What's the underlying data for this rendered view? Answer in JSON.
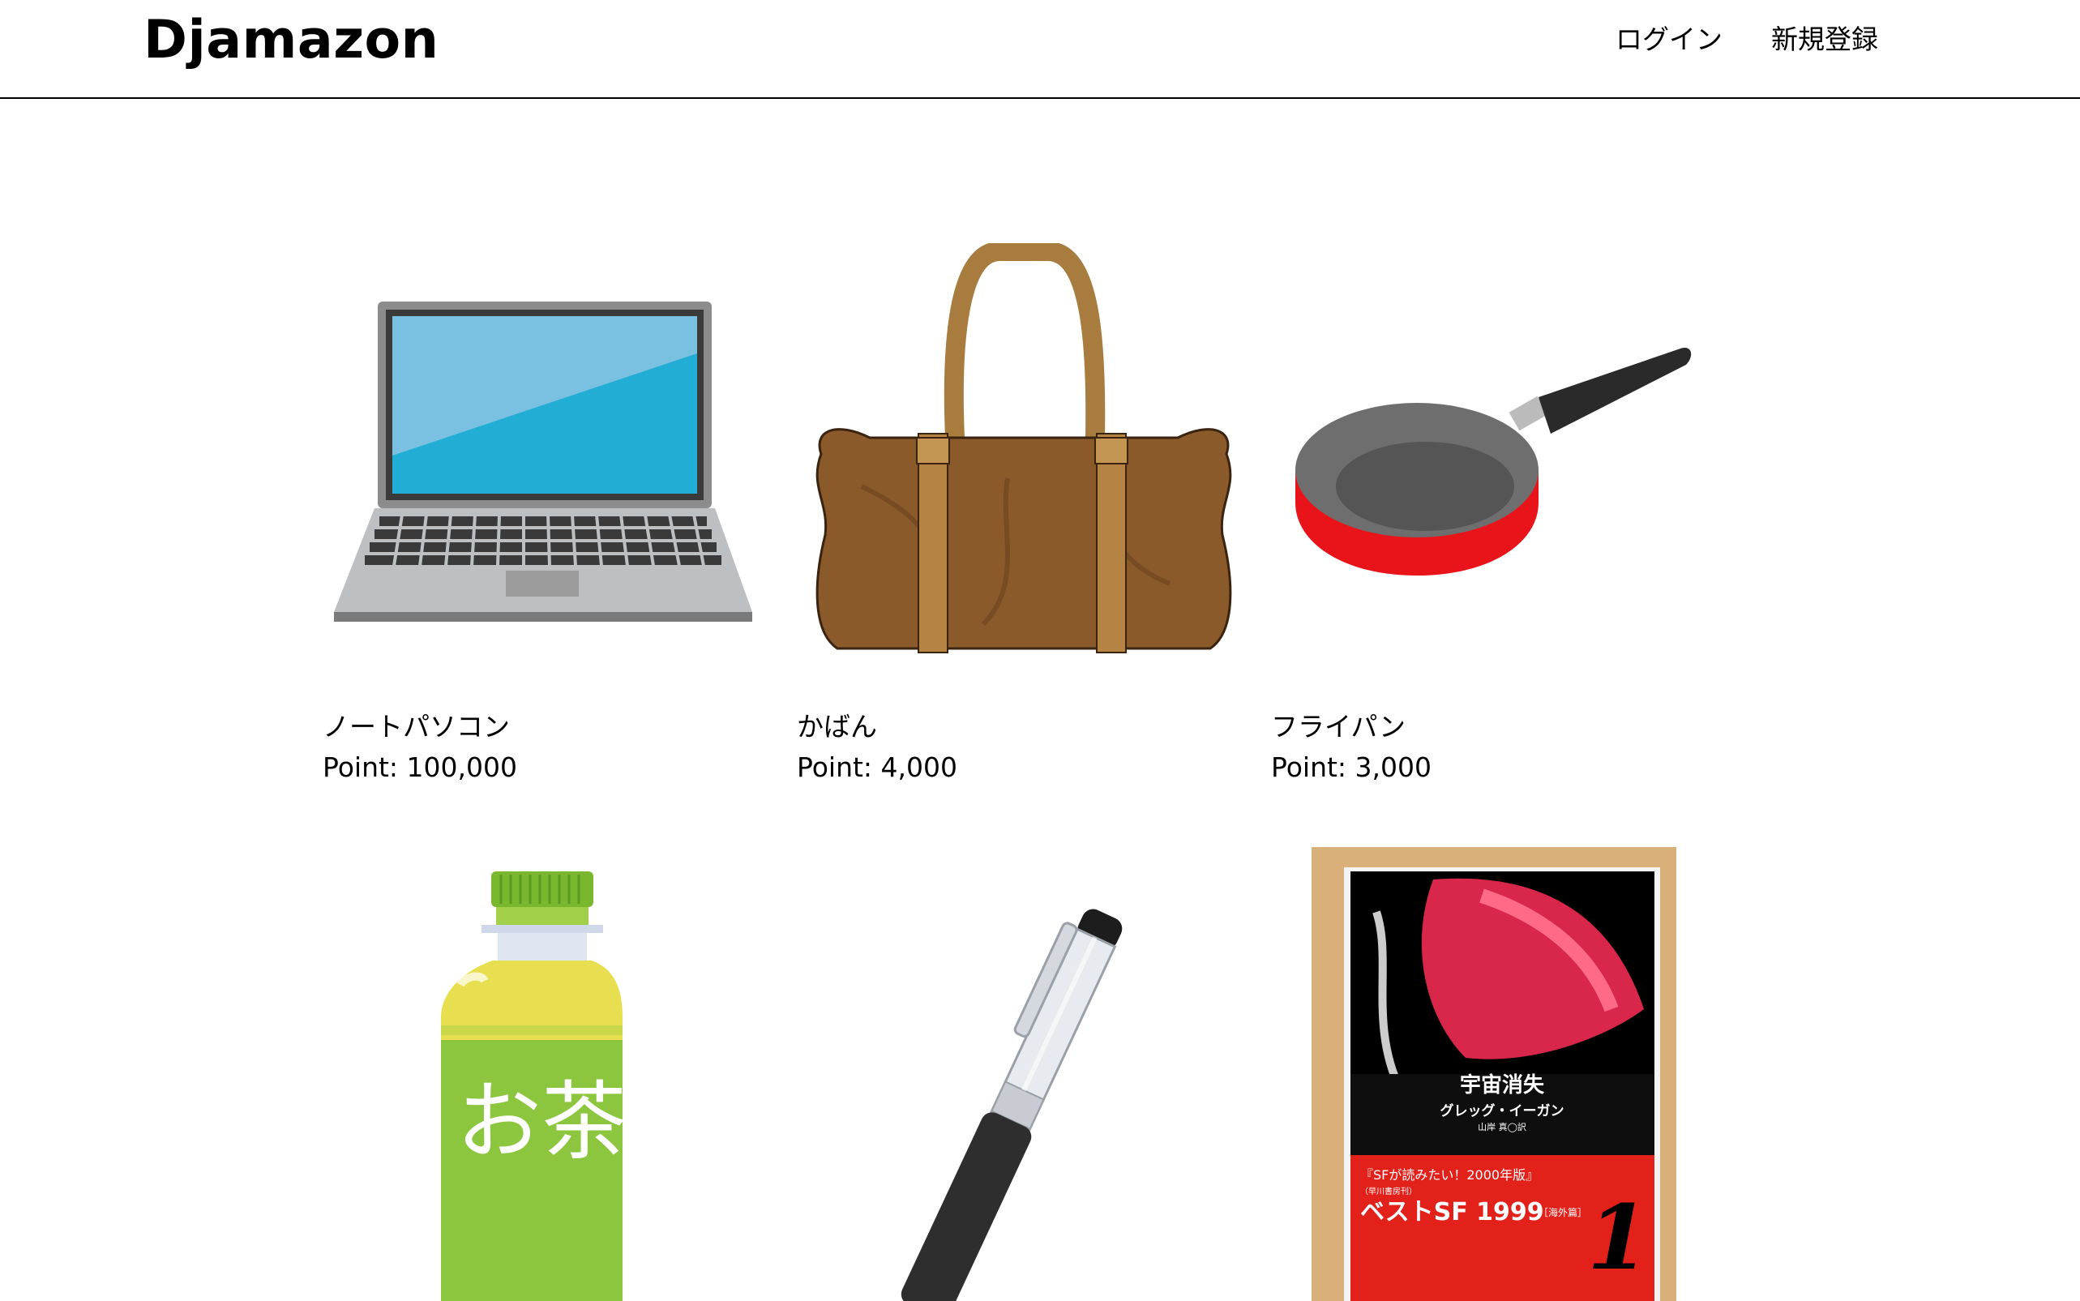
{
  "header": {
    "brand": "Djamazon",
    "nav": {
      "login": "ログイン",
      "signup": "新規登録"
    }
  },
  "products": [
    {
      "name": "ノートパソコン",
      "price": "Point: 100,000",
      "icon": "laptop-icon"
    },
    {
      "name": "かばん",
      "price": "Point: 4,000",
      "icon": "bag-icon"
    },
    {
      "name": "フライパン",
      "price": "Point: 3,000",
      "icon": "frying-pan-icon"
    },
    {
      "icon": "green-tea-bottle-icon",
      "label_text": "お茶"
    },
    {
      "icon": "pen-icon"
    },
    {
      "icon": "book-icon",
      "book_title": "宇宙消失",
      "book_author": "グレッグ・イーガン",
      "book_translator": "山岸 真◯訳",
      "band_line1": "『SFが読みたい！2000年版』",
      "band_line2": "（早川書房刊）",
      "band_line3": "ベストSF 1999",
      "band_line3b": "［海外篇］",
      "band_number": "1"
    }
  ]
}
